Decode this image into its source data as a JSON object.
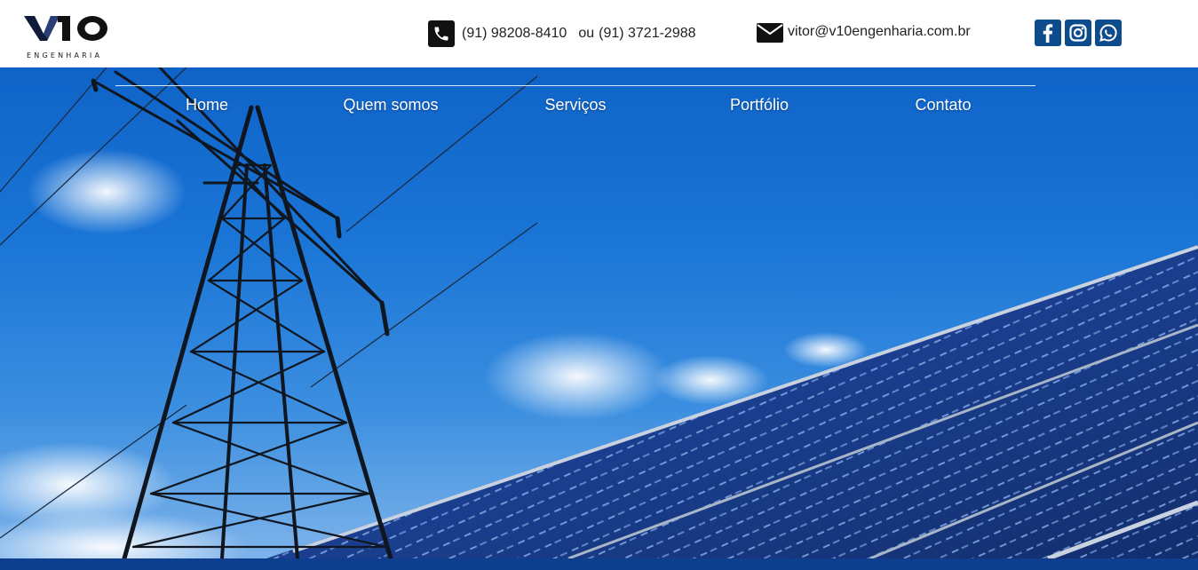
{
  "brand": {
    "logo_text": "V10",
    "logo_subtitle": "ENGENHARIA"
  },
  "header": {
    "phone_primary": "(91) 98208-8410",
    "phone_separator": "ou",
    "phone_secondary": "(91) 3721-2988",
    "email": "vitor@v10engenharia.com.br",
    "icons": {
      "phone": "phone-icon",
      "email": "envelope-icon"
    },
    "social": [
      {
        "name": "facebook",
        "icon": "facebook-icon"
      },
      {
        "name": "instagram",
        "icon": "instagram-icon"
      },
      {
        "name": "whatsapp",
        "icon": "whatsapp-icon"
      }
    ]
  },
  "nav": {
    "items": [
      {
        "label": "Home"
      },
      {
        "label": "Quem somos"
      },
      {
        "label": "Serviços"
      },
      {
        "label": "Portfólio"
      },
      {
        "label": "Contato"
      }
    ]
  },
  "colors": {
    "social_bg": "#0d4c8c",
    "bottom_bar": "#0e3f8e",
    "sky": "#1a75d6"
  }
}
